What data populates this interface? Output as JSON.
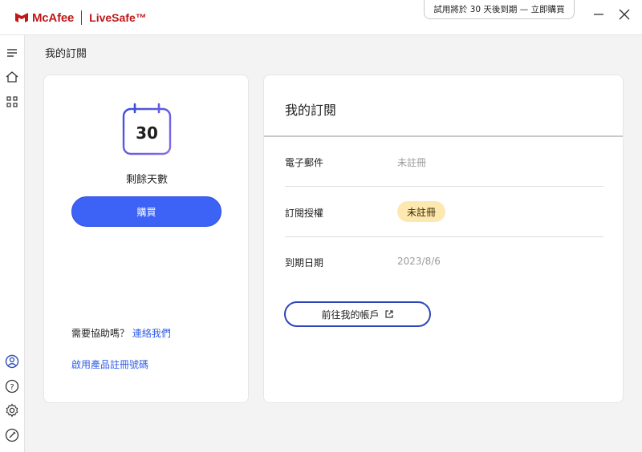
{
  "app": {
    "brand": "McAfee",
    "product": "LiveSafe™"
  },
  "trial_banner": "試用將於 30 天後到期 — 立即購買",
  "page_title": "我的訂閱",
  "left_card": {
    "calendar_day": "30",
    "days_label": "剩餘天數",
    "buy_label": "購買",
    "help_question": "需要協助嗎？",
    "contact_link": "連絡我們",
    "activate_link": "啟用產品註冊號碼"
  },
  "right_card": {
    "title": "我的訂閱",
    "rows": [
      {
        "label": "電子郵件",
        "value": "未註冊"
      },
      {
        "label": "訂閱授權",
        "value": "未註冊"
      },
      {
        "label": "到期日期",
        "value": "2023/8/6"
      }
    ],
    "account_button": "前往我的帳戶"
  },
  "colors": {
    "brand_red": "#c01818",
    "accent_blue": "#3c63f5",
    "badge_bg": "#fde8b0"
  },
  "icons": {
    "sidebar": [
      "menu-icon",
      "home-icon",
      "apps-icon",
      "account-icon",
      "help-icon",
      "settings-icon",
      "feedback-icon"
    ]
  }
}
